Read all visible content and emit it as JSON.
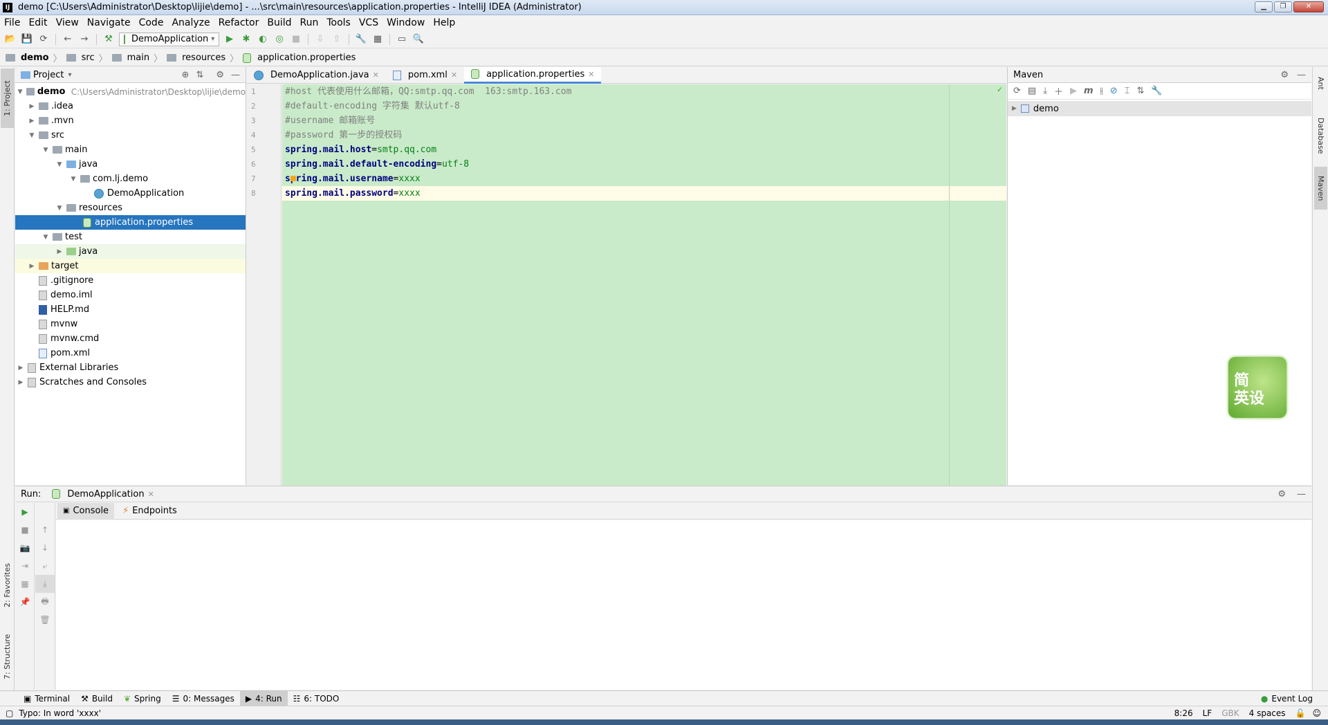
{
  "window": {
    "title": "demo [C:\\Users\\Administrator\\Desktop\\lijie\\demo] - ...\\src\\main\\resources\\application.properties - IntelliJ IDEA (Administrator)"
  },
  "menu": [
    "File",
    "Edit",
    "View",
    "Navigate",
    "Code",
    "Analyze",
    "Refactor",
    "Build",
    "Run",
    "Tools",
    "VCS",
    "Window",
    "Help"
  ],
  "toolbar": {
    "run_config": "DemoApplication"
  },
  "breadcrumb": [
    "demo",
    "src",
    "main",
    "resources",
    "application.properties"
  ],
  "left_strip": {
    "project": "1: Project",
    "favorites": "2: Favorites",
    "structure": "7: Structure"
  },
  "project_panel": {
    "title": "Project",
    "tree": [
      {
        "label": "demo",
        "extra": "C:\\Users\\Administrator\\Desktop\\lijie\\demo"
      },
      {
        "label": ".idea"
      },
      {
        "label": ".mvn"
      },
      {
        "label": "src"
      },
      {
        "label": "main"
      },
      {
        "label": "java"
      },
      {
        "label": "com.lj.demo"
      },
      {
        "label": "DemoApplication"
      },
      {
        "label": "resources"
      },
      {
        "label": "application.properties"
      },
      {
        "label": "test"
      },
      {
        "label": "java"
      },
      {
        "label": "target"
      },
      {
        "label": ".gitignore"
      },
      {
        "label": "demo.iml"
      },
      {
        "label": "HELP.md"
      },
      {
        "label": "mvnw"
      },
      {
        "label": "mvnw.cmd"
      },
      {
        "label": "pom.xml"
      },
      {
        "label": "External Libraries"
      },
      {
        "label": "Scratches and Consoles"
      }
    ]
  },
  "editor_tabs": [
    "DemoApplication.java",
    "pom.xml",
    "application.properties"
  ],
  "editor": {
    "line_numbers": [
      "1",
      "2",
      "3",
      "4",
      "5",
      "6",
      "7",
      "8"
    ],
    "comments": [
      "#host 代表使用什么邮箱，QQ:smtp.qq.com  163:smtp.163.com",
      "#default-encoding 字符集 默认utf-8",
      "#username 邮箱账号",
      "#password 第一步的授权码"
    ],
    "props": [
      {
        "key": "spring.mail.host",
        "value": "smtp.qq.com"
      },
      {
        "key": "spring.mail.default-encoding",
        "value": "utf-8"
      },
      {
        "key": "spring.mail.username",
        "value": "xxxx"
      },
      {
        "key": "spring.mail.password",
        "value": "xxxx"
      }
    ],
    "eq": "="
  },
  "maven": {
    "title": "Maven",
    "project": "demo"
  },
  "right_strip": {
    "ant": "Ant",
    "database": "Database",
    "maven": "Maven"
  },
  "widget": {
    "line1": "简",
    "line2": "英设"
  },
  "run": {
    "label": "Run:",
    "config": "DemoApplication",
    "tabs": [
      "Console",
      "Endpoints"
    ]
  },
  "bottom_tabs": [
    "Terminal",
    "Build",
    "Spring",
    "0: Messages",
    "4: Run",
    "6: TODO"
  ],
  "event_log": "Event Log",
  "status": {
    "message": "Typo: In word 'xxxx'",
    "position": "8:26",
    "line_sep": "LF",
    "encoding": "GBK",
    "indent": "4 spaces"
  }
}
